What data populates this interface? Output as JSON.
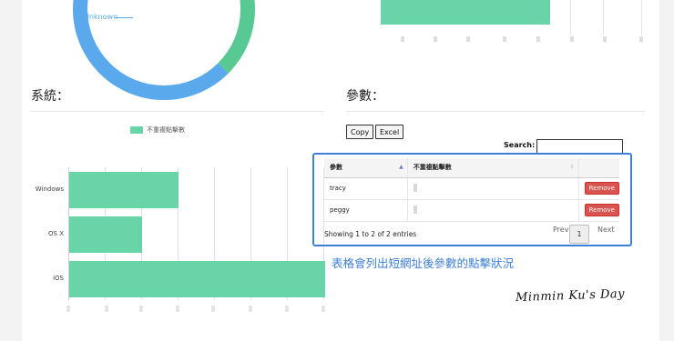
{
  "top": {
    "donut_label": "Unknown"
  },
  "left_section": {
    "title": "系統：",
    "legend": "不重複點擊數",
    "chart_data": {
      "type": "bar",
      "orientation": "horizontal",
      "categories": [
        "Windows",
        "OS X",
        "iOS"
      ],
      "series": [
        {
          "name": "不重複點擊數",
          "values": [
            2.4,
            1.6,
            5.6
          ]
        }
      ],
      "xlim": [
        0,
        5.6
      ],
      "grid": true,
      "colors": {
        "bar": "#6ad4a9"
      }
    }
  },
  "right_section": {
    "title": "參數：",
    "buttons": {
      "copy": "Copy",
      "excel": "Excel"
    },
    "search_label": "Search:",
    "table": {
      "headers": [
        "參數",
        "不重複點擊數",
        ""
      ],
      "rows": [
        {
          "param": "tracy",
          "action": "Remove"
        },
        {
          "param": "peggy",
          "action": "Remove"
        }
      ]
    },
    "info": "Showing 1 to 2 of 2 entries",
    "pagination": {
      "previous": "Previous",
      "current": "1",
      "next": "Next"
    },
    "caption": "表格會列出短網址後參數的點擊狀況"
  },
  "signature": "Minmin Ku's Day",
  "colors": {
    "accent": "#3d7fd6",
    "bar": "#6ad4a9",
    "danger": "#d9534f"
  }
}
